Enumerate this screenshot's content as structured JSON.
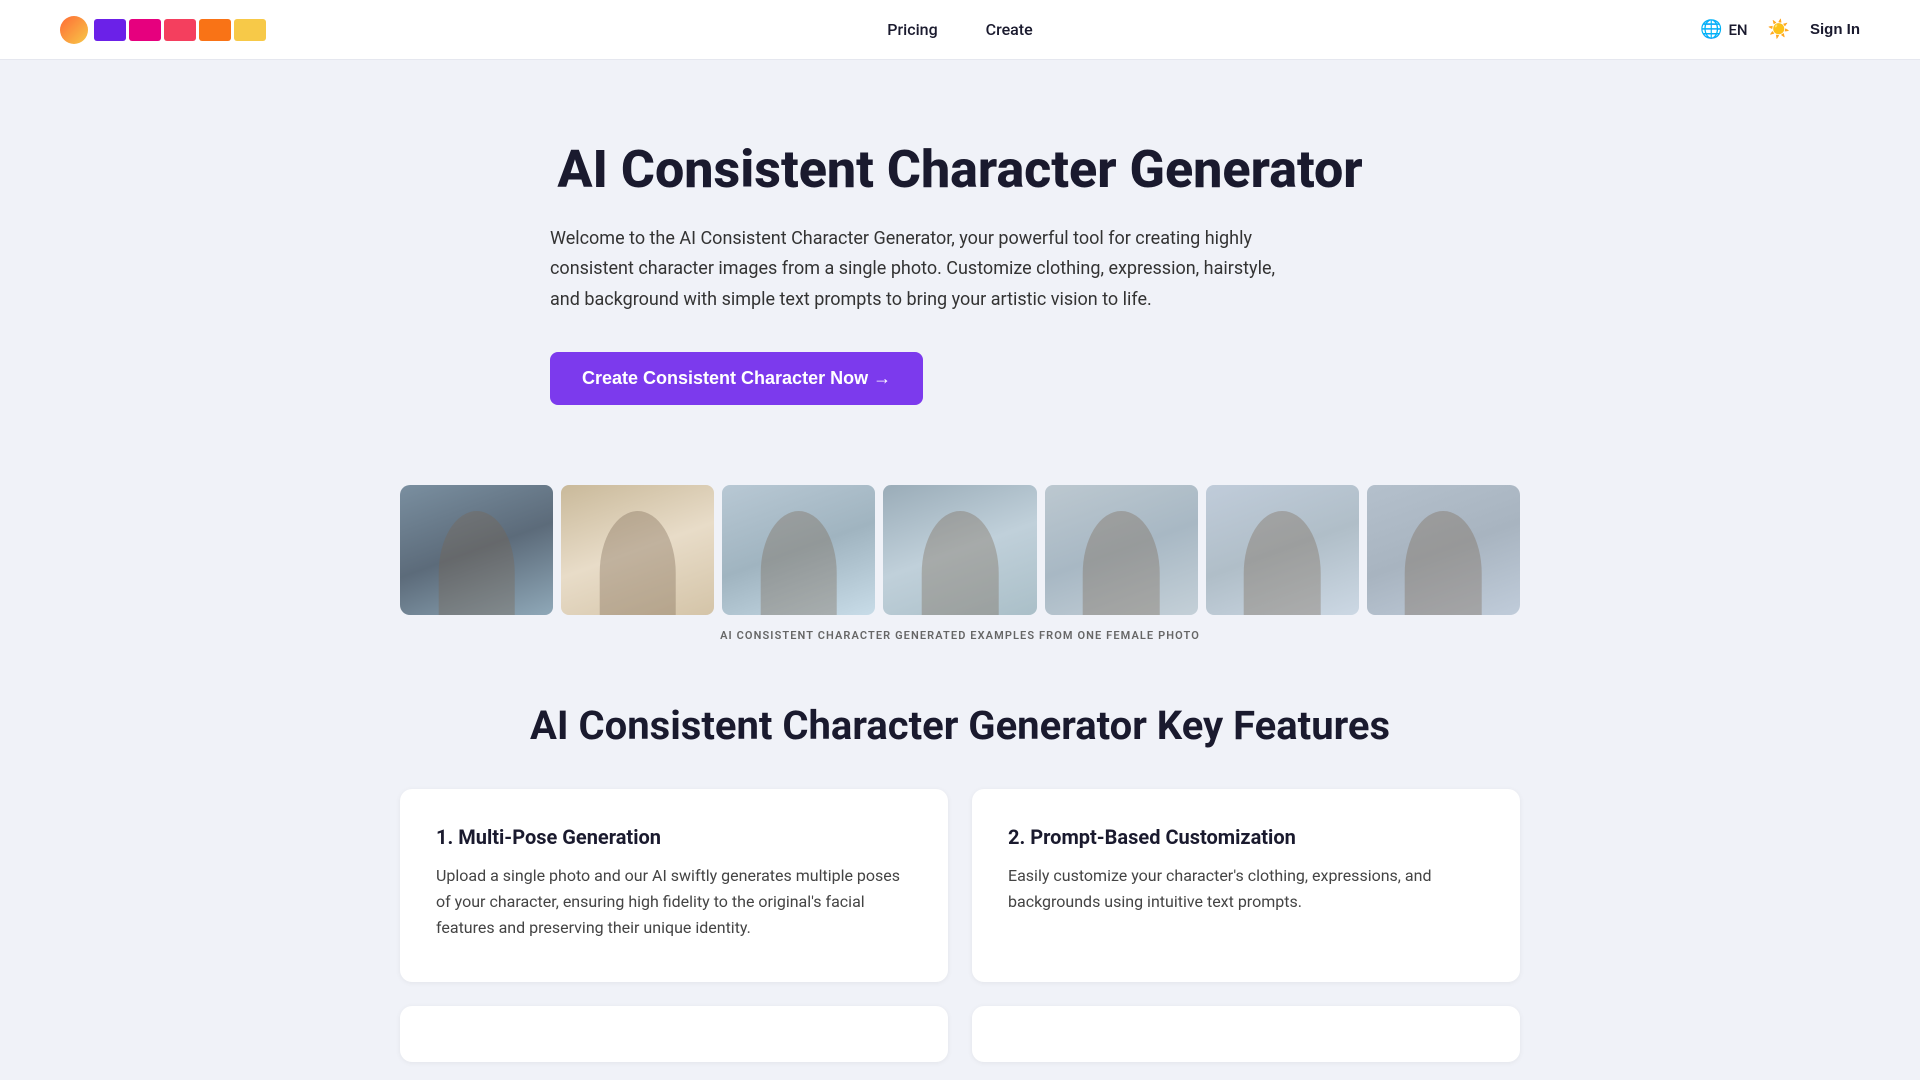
{
  "nav": {
    "pricing_label": "Pricing",
    "create_label": "Create",
    "lang_label": "EN",
    "sign_in_label": "Sign In"
  },
  "hero": {
    "title": "AI Consistent Character Generator",
    "description": "Welcome to the AI Consistent Character Generator, your powerful tool for creating highly consistent character images from a single photo. Customize clothing, expression, hairstyle, and background with simple text prompts to bring your artistic vision to life.",
    "cta_label": "Create Consistent Character Now →"
  },
  "gallery": {
    "caption": "AI CONSISTENT CHARACTER GENERATED EXAMPLES FROM ONE FEMALE PHOTO",
    "images": [
      {
        "id": "img-1",
        "alt": "Character example 1"
      },
      {
        "id": "img-2",
        "alt": "Character example 2"
      },
      {
        "id": "img-3",
        "alt": "Character example 3"
      },
      {
        "id": "img-4",
        "alt": "Character example 4"
      },
      {
        "id": "img-5",
        "alt": "Character example 5"
      },
      {
        "id": "img-6",
        "alt": "Character example 6"
      },
      {
        "id": "img-7",
        "alt": "Character example 7"
      }
    ]
  },
  "features": {
    "section_title": "AI Consistent Character Generator Key Features",
    "cards": [
      {
        "id": "feature-1",
        "title": "1. Multi-Pose Generation",
        "description": "Upload a single photo and our AI swiftly generates multiple poses of your character, ensuring high fidelity to the original's facial features and preserving their unique identity."
      },
      {
        "id": "feature-2",
        "title": "2. Prompt-Based Customization",
        "description": "Easily customize your character's clothing, expressions, and backgrounds using intuitive text prompts."
      }
    ]
  }
}
